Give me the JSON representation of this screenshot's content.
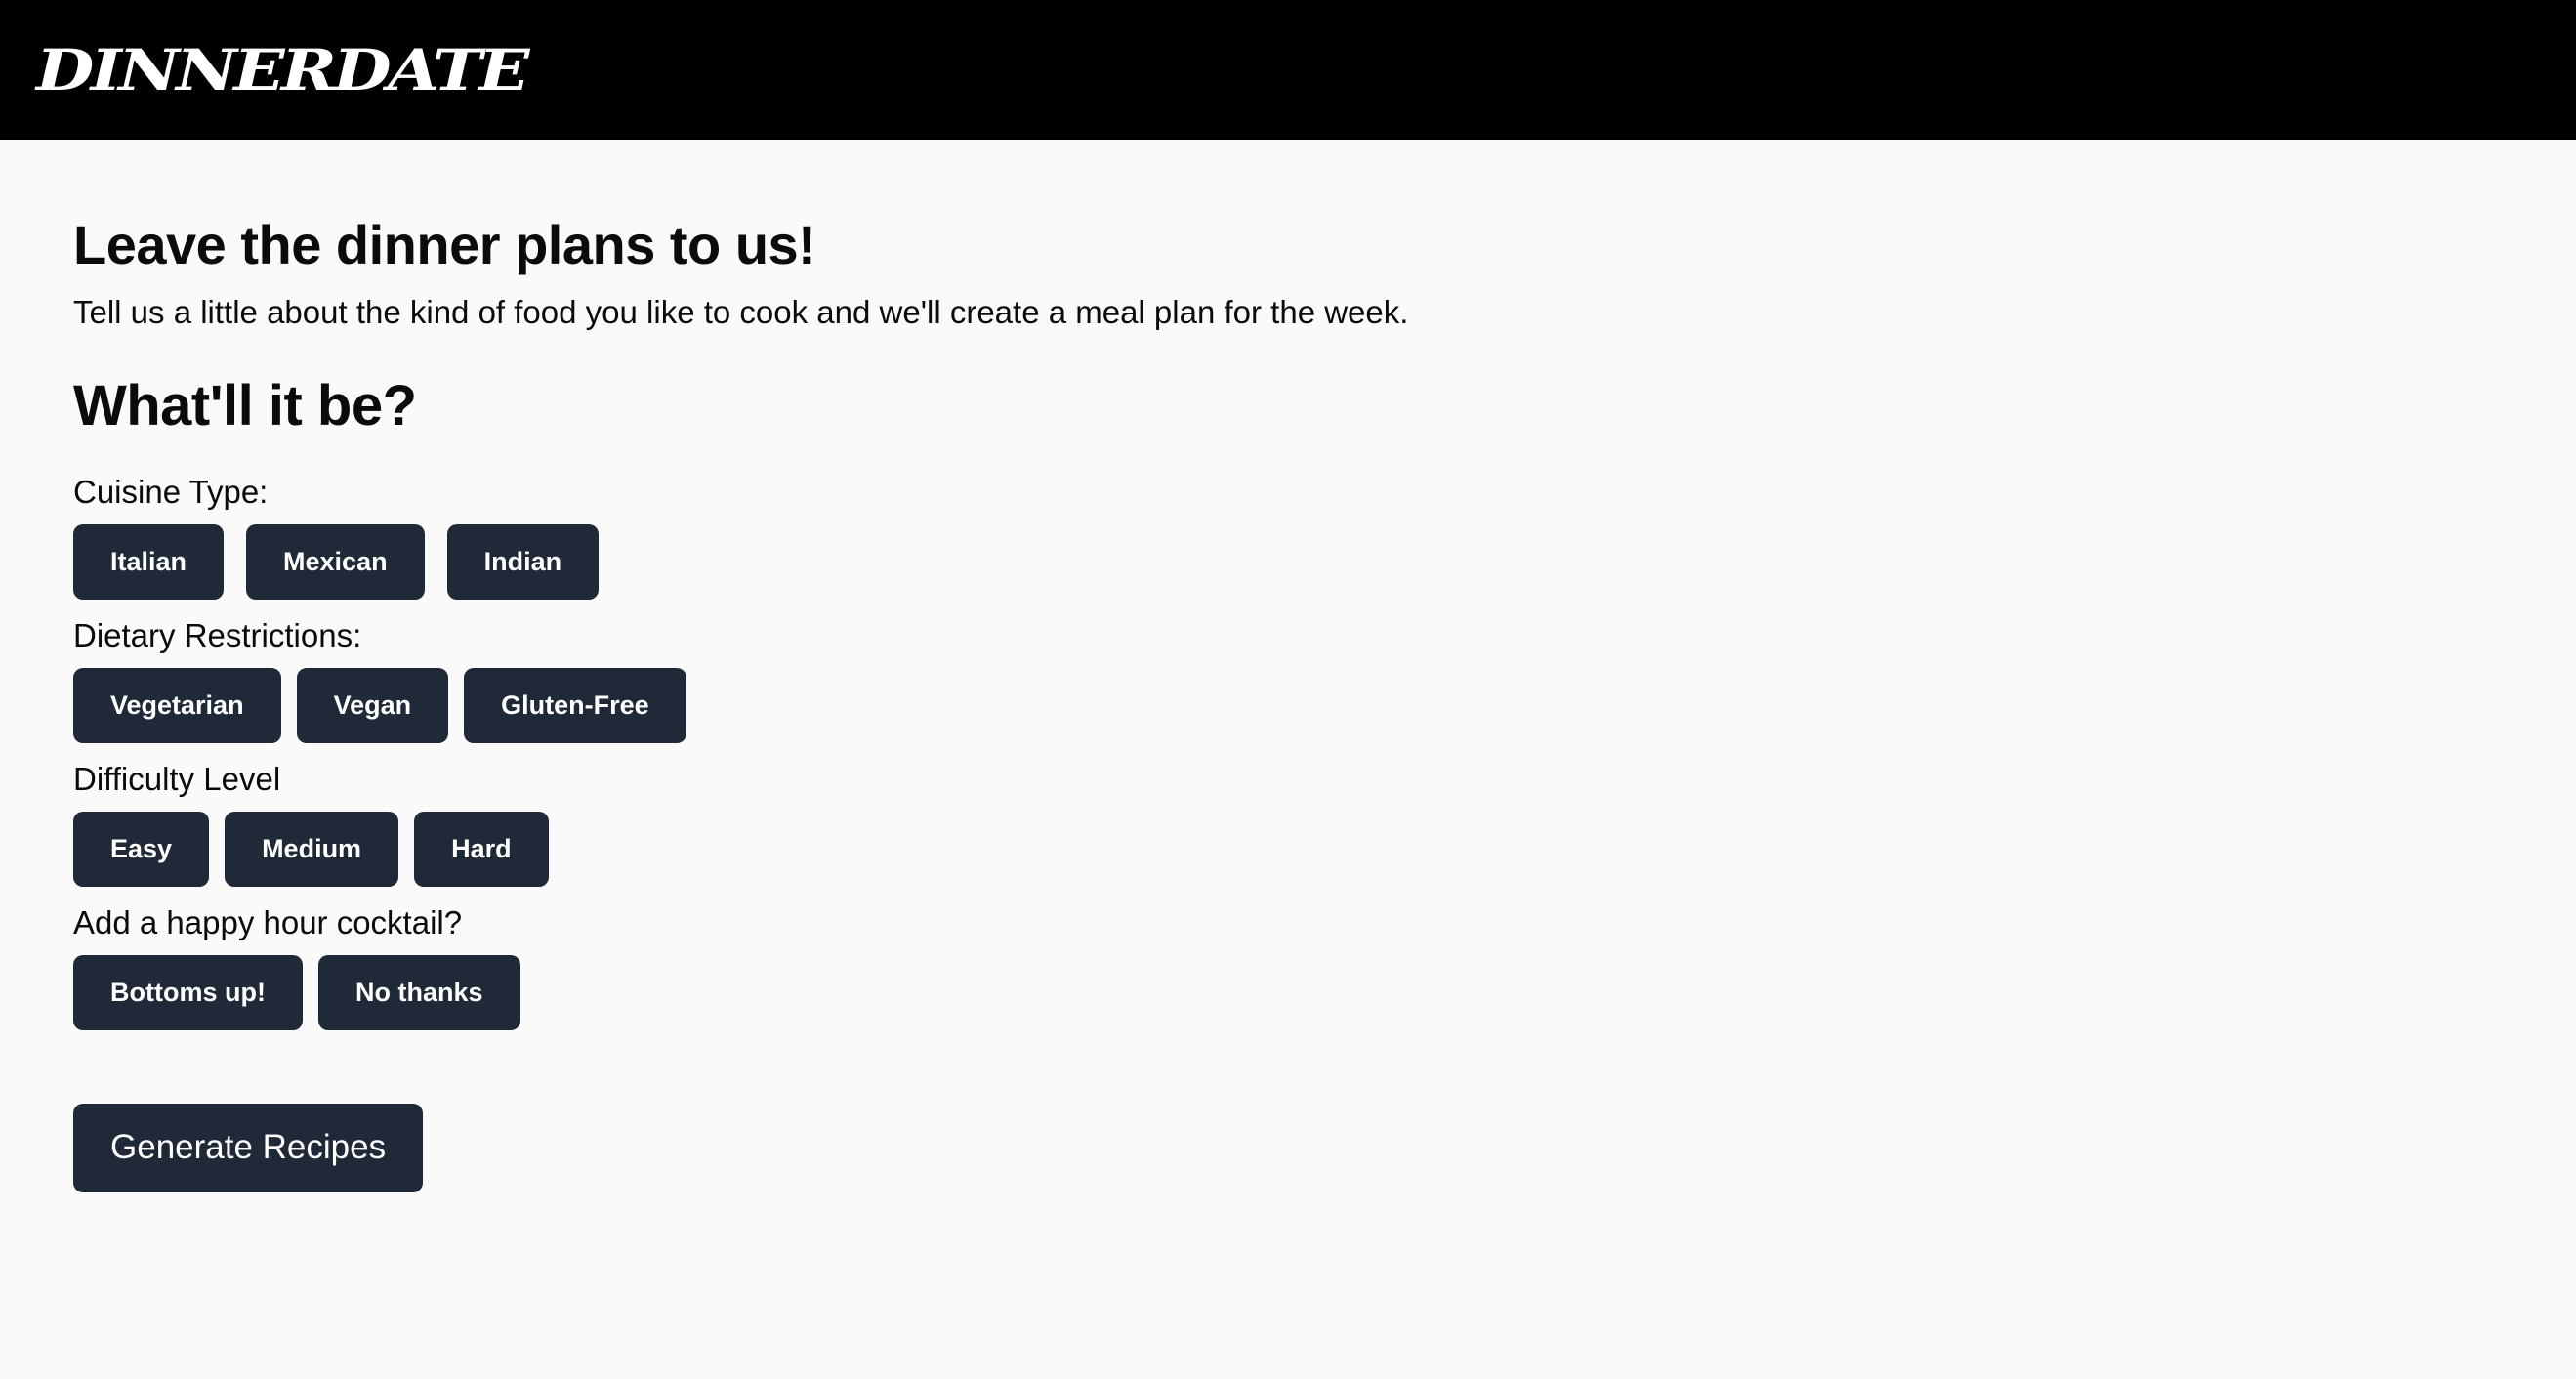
{
  "header": {
    "logo_text": "DINNERDATE"
  },
  "main": {
    "title": "Leave the dinner plans to us!",
    "intro": "Tell us a little about the kind of food you like to cook and we'll create a meal plan for the week.",
    "section_title": "What'll it be?",
    "groups": [
      {
        "label": "Cuisine Type:",
        "options": [
          "Italian",
          "Mexican",
          "Indian"
        ]
      },
      {
        "label": "Dietary Restrictions:",
        "options": [
          "Vegetarian",
          "Vegan",
          "Gluten-Free"
        ]
      },
      {
        "label": "Difficulty Level",
        "options": [
          "Easy",
          "Medium",
          "Hard"
        ]
      },
      {
        "label": "Add a happy hour cocktail?",
        "options": [
          "Bottoms up!",
          "No thanks"
        ]
      }
    ],
    "generate_label": "Generate Recipes"
  },
  "colors": {
    "header_bg": "#000000",
    "page_bg": "#fafafa",
    "button_bg": "#1f2937",
    "button_text": "#ffffff"
  }
}
